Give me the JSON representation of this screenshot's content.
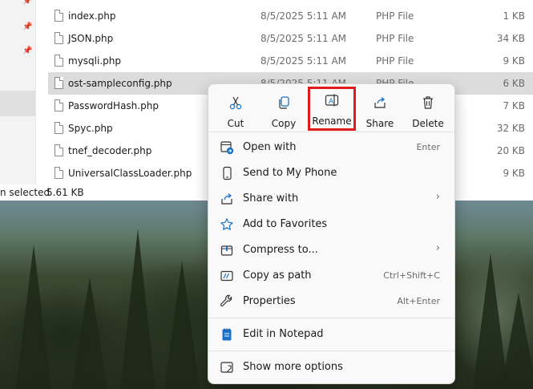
{
  "files": [
    {
      "name": "index.php",
      "date": "8/5/2025 5:11 AM",
      "type": "PHP File",
      "size": "1 KB",
      "selected": false
    },
    {
      "name": "JSON.php",
      "date": "8/5/2025 5:11 AM",
      "type": "PHP File",
      "size": "34 KB",
      "selected": false
    },
    {
      "name": "mysqli.php",
      "date": "8/5/2025 5:11 AM",
      "type": "PHP File",
      "size": "9 KB",
      "selected": false
    },
    {
      "name": "ost-sampleconfig.php",
      "date": "8/5/2025 5:11 AM",
      "type": "PHP File",
      "size": "6 KB",
      "selected": true
    },
    {
      "name": "PasswordHash.php",
      "date": "",
      "type": "",
      "size": "7 KB",
      "selected": false
    },
    {
      "name": "Spyc.php",
      "date": "",
      "type": "",
      "size": "32 KB",
      "selected": false
    },
    {
      "name": "tnef_decoder.php",
      "date": "",
      "type": "",
      "size": "20 KB",
      "selected": false
    },
    {
      "name": "UniversalClassLoader.php",
      "date": "",
      "type": "",
      "size": "9 KB",
      "selected": false
    }
  ],
  "status_bar": {
    "selection_text": "n selected",
    "selection_size": "5.61 KB"
  },
  "context_menu": {
    "quick_actions": [
      {
        "label": "Cut",
        "icon": "scissors-icon",
        "highlighted": false
      },
      {
        "label": "Copy",
        "icon": "copy-icon",
        "highlighted": false
      },
      {
        "label": "Rename",
        "icon": "rename-icon",
        "highlighted": true
      },
      {
        "label": "Share",
        "icon": "share-icon",
        "highlighted": false
      },
      {
        "label": "Delete",
        "icon": "trash-icon",
        "highlighted": false
      }
    ],
    "items": [
      {
        "label": "Open with",
        "shortcut": "Enter",
        "submenu": false,
        "icon": "open-with-icon"
      },
      {
        "label": "Send to My Phone",
        "shortcut": "",
        "submenu": false,
        "icon": "phone-icon"
      },
      {
        "label": "Share with",
        "shortcut": "",
        "submenu": true,
        "icon": "share-with-icon"
      },
      {
        "label": "Add to Favorites",
        "shortcut": "",
        "submenu": false,
        "icon": "star-icon"
      },
      {
        "label": "Compress to...",
        "shortcut": "",
        "submenu": true,
        "icon": "archive-icon"
      },
      {
        "label": "Copy as path",
        "shortcut": "Ctrl+Shift+C",
        "submenu": false,
        "icon": "path-icon"
      },
      {
        "label": "Properties",
        "shortcut": "Alt+Enter",
        "submenu": false,
        "icon": "wrench-icon"
      },
      {
        "label": "Edit in Notepad",
        "shortcut": "",
        "submenu": false,
        "icon": "notepad-icon"
      },
      {
        "label": "Show more options",
        "shortcut": "",
        "submenu": false,
        "icon": "more-options-icon"
      }
    ],
    "submenu_arrow": "›"
  },
  "colors": {
    "highlight_border": "#e01b1b",
    "accent_blue": "#1a73c7"
  }
}
